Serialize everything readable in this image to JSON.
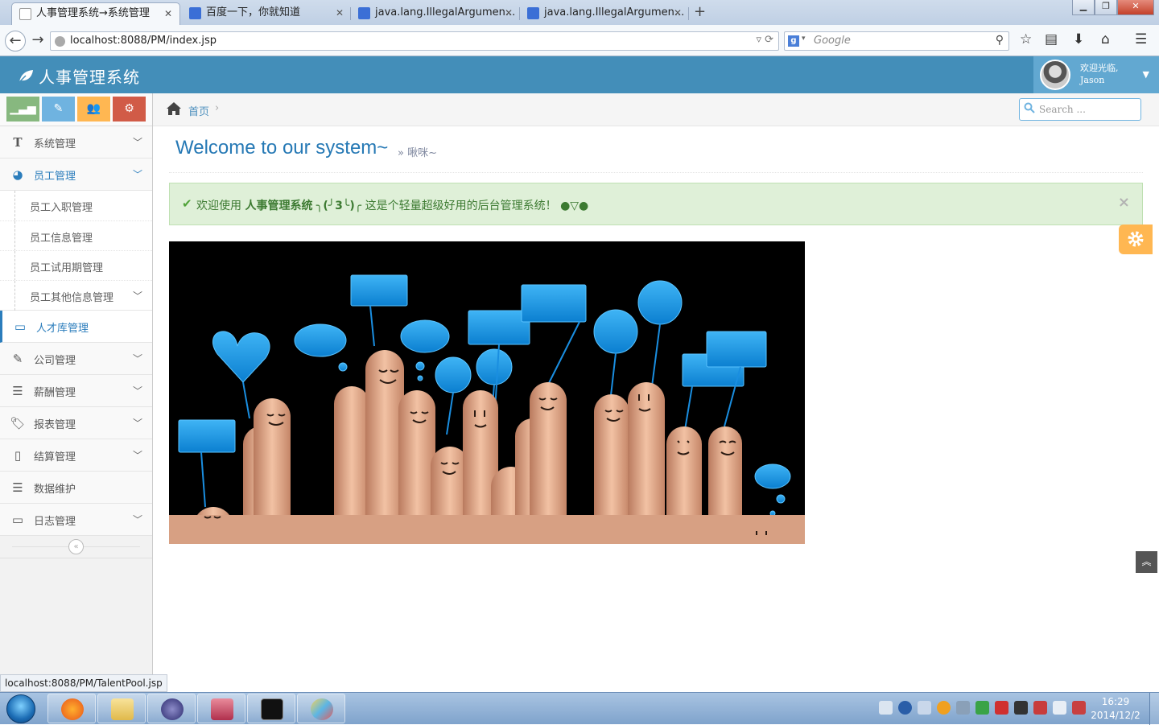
{
  "browser": {
    "tabs": [
      {
        "title": "人事管理系统→系统管理",
        "active": true
      },
      {
        "title": "百度一下，你就知道",
        "active": false
      },
      {
        "title": "java.lang.IllegalArgumen...",
        "active": false
      },
      {
        "title": "java.lang.IllegalArgumen...",
        "active": false
      }
    ],
    "url": "localhost:8088/PM/index.jsp",
    "search_placeholder": "Google",
    "status_url": "localhost:8088/PM/TalentPool.jsp"
  },
  "app": {
    "name": "人事管理系统",
    "brand_color": "#438eb9",
    "user": {
      "greeting": "欢迎光临,",
      "name": "Jason"
    }
  },
  "shortcuts": [
    {
      "icon": "signal-icon",
      "color": "#87b87f"
    },
    {
      "icon": "pencil-icon",
      "color": "#6fb3e0"
    },
    {
      "icon": "group-icon",
      "color": "#ffb752"
    },
    {
      "icon": "cogs-icon",
      "color": "#d15b47"
    }
  ],
  "sidebar": {
    "items": [
      {
        "label": "系统管理",
        "icon": "text-width-icon"
      },
      {
        "label": "员工管理",
        "icon": "dashboard-icon"
      },
      {
        "label": "人才库管理",
        "icon": "desktop-icon"
      },
      {
        "label": "公司管理",
        "icon": "edit-icon"
      },
      {
        "label": "薪酬管理",
        "icon": "list-icon"
      },
      {
        "label": "报表管理",
        "icon": "tag-icon"
      },
      {
        "label": "结算管理",
        "icon": "file-icon"
      },
      {
        "label": "数据维护",
        "icon": "list-icon"
      },
      {
        "label": "日志管理",
        "icon": "desktop-icon"
      }
    ],
    "employee_sub": [
      "员工入职管理",
      "员工信息管理",
      "员工试用期管理",
      "员工其他信息管理"
    ]
  },
  "breadcrumb": {
    "home": "首页"
  },
  "nav_search_placeholder": "Search ...",
  "page": {
    "title": "Welcome to our system~",
    "subtitle": "啾咪~"
  },
  "alert": {
    "prefix": "欢迎使用",
    "system_name": "人事管理系统",
    "emoticon": "╮(╯3╰)╭",
    "suffix": "这是个轻量超级好用的后台管理系统！ ●▽●"
  },
  "taskbar": {
    "time": "16:29",
    "date": "2014/12/2"
  }
}
